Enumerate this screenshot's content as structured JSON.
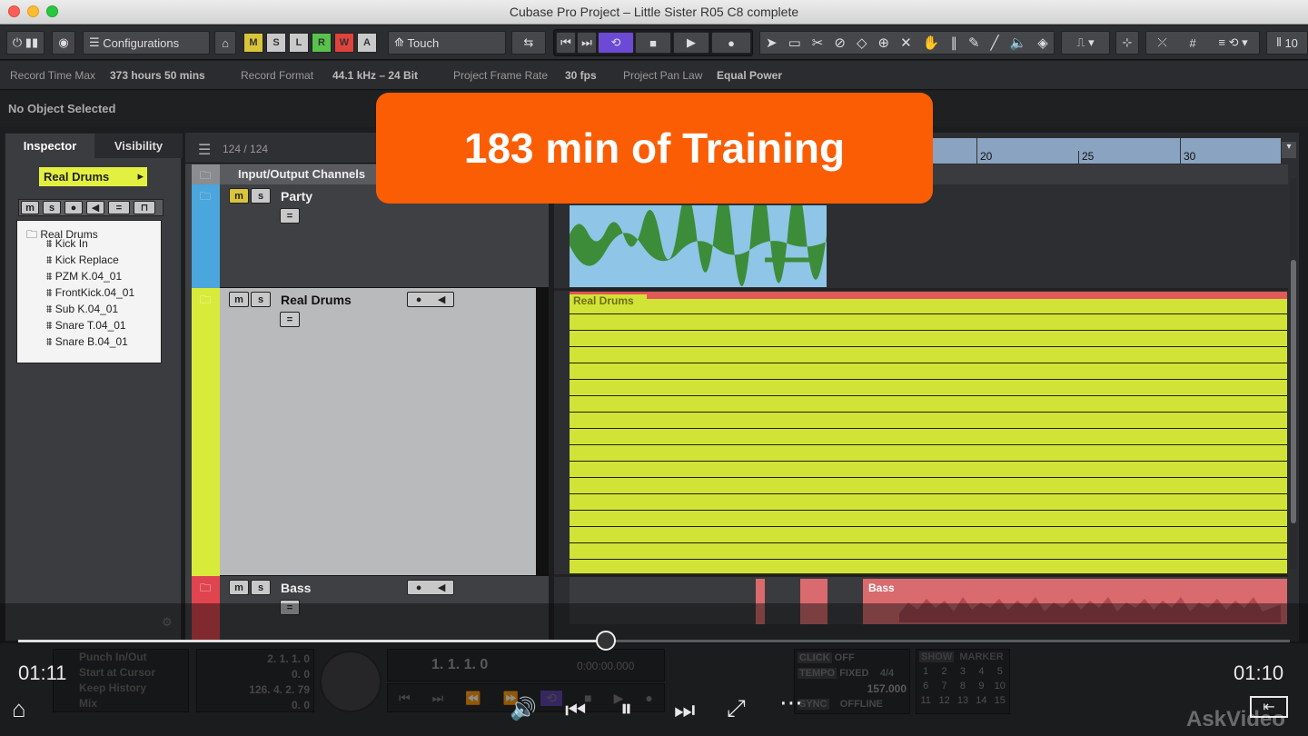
{
  "window": {
    "title": "Cubase Pro Project – Little Sister R05 C8 complete"
  },
  "toolbar": {
    "configurations": "Configurations",
    "automation_mode": "Touch",
    "letters": [
      "M",
      "S",
      "L",
      "R",
      "W",
      "A"
    ],
    "colors": {
      "M": "#d8c53a",
      "S": "#c9c9c9",
      "L": "#c9c9c9",
      "R": "#58c24a",
      "W": "#e0433c",
      "A": "#c9c9c9"
    },
    "right_value": "10"
  },
  "info": {
    "record_time_label": "Record Time Max",
    "record_time_value": "373 hours 50 mins",
    "record_format_label": "Record Format",
    "record_format_value": "44.1 kHz – 24 Bit",
    "frame_rate_label": "Project Frame Rate",
    "frame_rate_value": "30 fps",
    "pan_law_label": "Project Pan Law",
    "pan_law_value": "Equal Power"
  },
  "status": {
    "selection": "No Object Selected"
  },
  "inspector": {
    "tab_inspector": "Inspector",
    "tab_visibility": "Visibility",
    "track_name": "Real Drums",
    "folder": "Real Drums",
    "items": [
      "Kick In",
      "Kick Replace",
      "PZM K.04_01",
      "FrontKick.04_01",
      "Sub K.04_01",
      "Snare T.04_01",
      "Snare B.04_01"
    ]
  },
  "tracklist": {
    "count": "124 / 124",
    "tracks": [
      {
        "name": "Input/Output Channels",
        "color": "#8a8c90"
      },
      {
        "name": "Party",
        "color": "#4aa6dc"
      },
      {
        "name": "Real Drums",
        "color": "#d8ea3a"
      },
      {
        "name": "Bass",
        "color": "#e0444e"
      }
    ]
  },
  "ruler": {
    "marks": [
      "20",
      "25",
      "30"
    ]
  },
  "parts": {
    "drums": "Real Drums",
    "bass": "Bass"
  },
  "banner": {
    "text": "183 min of Training"
  },
  "transport": {
    "punch": "Punch In/Out",
    "start": "Start at Cursor",
    "keep": "Keep History",
    "mix": "Mix",
    "left_loc": "2. 1. 1.  0",
    "left_zero": "0.  0",
    "right_loc": "126. 4. 2. 79",
    "right_zero": "0.  0",
    "position": "1.  1.  1.    0",
    "time": "0:00:00.000",
    "click": "CLICK",
    "click_val": "OFF",
    "tempo": "TEMPO",
    "tempo_val": "FIXED",
    "sig": "4/4",
    "bpm": "157.000",
    "sync": "SYNC",
    "sync_val": "OFFLINE",
    "show": "SHOW",
    "marker": "MARKER",
    "markers": [
      "1",
      "2",
      "3",
      "4",
      "5",
      "6",
      "7",
      "8",
      "9",
      "10",
      "11",
      "12",
      "13",
      "14",
      "15"
    ]
  },
  "player": {
    "elapsed": "01:11",
    "remaining": "01:10",
    "progress": 0.46,
    "watermark": "AskVideo"
  }
}
